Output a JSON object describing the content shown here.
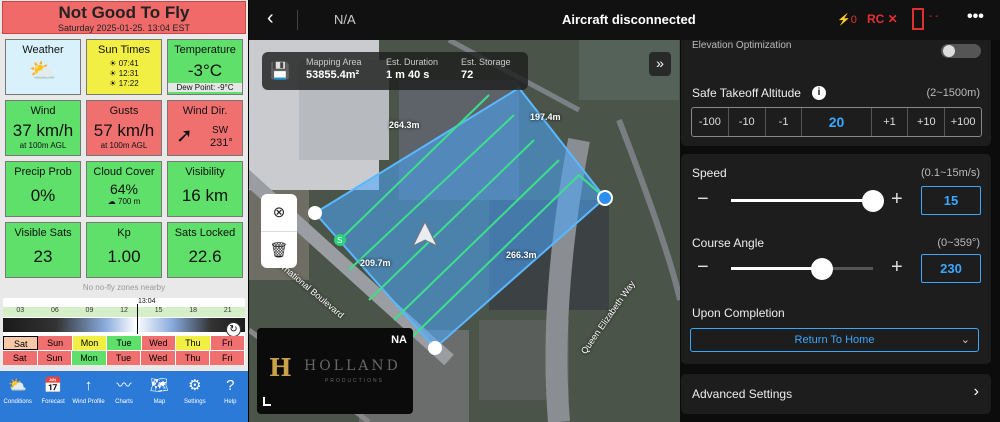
{
  "left": {
    "verdict": "Not Good To Fly",
    "datetime": "Saturday 2025-01-25. 13:04 EST",
    "tiles": {
      "weather": {
        "label": "Weather"
      },
      "sun": {
        "label": "Sun Times",
        "rise": "07:41",
        "noon": "12:31",
        "set": "17:22"
      },
      "temp": {
        "label": "Temperature",
        "value": "-3°C",
        "sub": "Dew Point: -9°C"
      },
      "wind": {
        "label": "Wind",
        "value": "37 km/h",
        "sub": "at 100m AGL"
      },
      "gusts": {
        "label": "Gusts",
        "value": "57 km/h",
        "sub": "at 100m AGL"
      },
      "winddir": {
        "label": "Wind Dir.",
        "dir": "SW",
        "deg": "231°"
      },
      "precip": {
        "label": "Precip Prob",
        "value": "0%"
      },
      "cloud": {
        "label": "Cloud Cover",
        "value": "64%",
        "sub": "700 m"
      },
      "visibility": {
        "label": "Visibility",
        "value": "16 km"
      },
      "sats": {
        "label": "Visible Sats",
        "value": "23"
      },
      "kp": {
        "label": "Kp",
        "value": "1.00"
      },
      "locked": {
        "label": "Sats Locked",
        "value": "22.6"
      }
    },
    "nofly": "No no-fly zones nearby",
    "now": "13:04",
    "hours": [
      "03",
      "06",
      "09",
      "12",
      "15",
      "18",
      "21"
    ],
    "days_row1": [
      "Sat",
      "Sun",
      "Mon",
      "Tue",
      "Wed",
      "Thu",
      "Fri"
    ],
    "days_row2": [
      "Sat",
      "Sun",
      "Mon",
      "Tue",
      "Wed",
      "Thu",
      "Fri"
    ],
    "nav": [
      "Conditions",
      "Forecast",
      "Wind Profile",
      "Charts",
      "Map",
      "Settings",
      "Help"
    ]
  },
  "top": {
    "na": "N/A",
    "title": "Aircraft disconnected",
    "rc_count": "0",
    "rc": "RC ✕",
    "batt": "- -"
  },
  "map": {
    "mapping_area_label": "Mapping Area",
    "mapping_area": "53855.4m²",
    "duration_label": "Est. Duration",
    "duration": "1 m 40 s",
    "storage_label": "Est. Storage",
    "storage": "72",
    "dims": [
      "264.3m",
      "197.4m",
      "209.7m",
      "266.3m"
    ],
    "street1": "International Boulevard",
    "street2": "Queen Elizabeth Way",
    "logo_tag": "NA",
    "logo_word": "HOLLAND",
    "logo_sub": "PRODUCTIONS"
  },
  "right": {
    "elev_label": "Elevation Optimization",
    "safe_label": "Safe Takeoff Altitude",
    "safe_range": "(2~1500m)",
    "alt_buttons": [
      "-100",
      "-10",
      "-1",
      "20",
      "+1",
      "+10",
      "+100"
    ],
    "speed_label": "Speed",
    "speed_range": "(0.1~15m/s)",
    "speed_value": "15",
    "speed_fraction": 1.0,
    "course_label": "Course Angle",
    "course_range": "(0~359°)",
    "course_value": "230",
    "course_fraction": 0.64,
    "completion_label": "Upon Completion",
    "completion_value": "Return To Home",
    "advanced_label": "Advanced Settings"
  }
}
